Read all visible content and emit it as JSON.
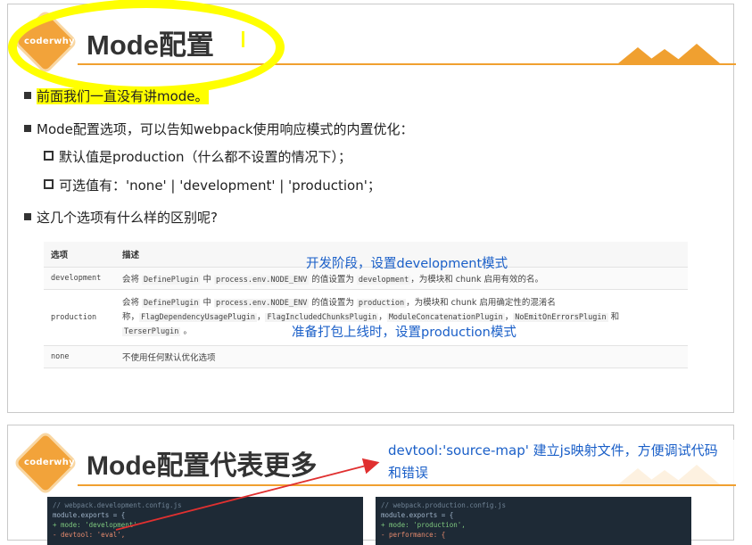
{
  "slide1": {
    "logo_text": "coderwhy",
    "title": "Mode配置",
    "cursor": "I",
    "bullets": [
      "前面我们一直没有讲mode。",
      "Mode配置选项，可以告知webpack使用响应模式的内置优化：",
      "默认值是production（什么都不设置的情况下）；",
      "可选值有：'none' | 'development' | 'production'；",
      "这几个选项有什么样的区别呢?"
    ],
    "table": {
      "headers": [
        "选项",
        "描述"
      ],
      "rows": [
        {
          "option": "development",
          "desc_parts": [
            "会将 ",
            "DefinePlugin",
            " 中 ",
            "process.env.NODE_ENV",
            " 的值设置为 ",
            "development",
            "，为模块和 chunk 启用有效的名。"
          ]
        },
        {
          "option": "production",
          "desc_line1_parts": [
            "会将 ",
            "DefinePlugin",
            " 中 ",
            "process.env.NODE_ENV",
            " 的值设置为 ",
            "production",
            "，为模块和 chunk 启用确定性的混淆名"
          ],
          "desc_line2_parts": [
            "称，",
            "FlagDependencyUsagePlugin",
            "，",
            "FlagIncludedChunksPlugin",
            "，",
            "ModuleConcatenationPlugin",
            "，",
            "NoEmitOnErrorsPlugin",
            " 和"
          ],
          "desc_line3_parts": [
            "TerserPlugin",
            " 。"
          ]
        },
        {
          "option": "none",
          "desc": "不使用任何默认优化选项"
        }
      ]
    },
    "annotations": {
      "dev": "开发阶段，设置development模式",
      "prod": "准备打包上线时，设置production模式"
    }
  },
  "slide2": {
    "logo_text": "coderwhy",
    "title": "Mode配置代表更多",
    "annotation_line1": "devtool:'source-map' 建立js映射文件，方便调试代码",
    "annotation_line2": "和错误",
    "code_left": {
      "lines": [
        "// webpack.development.config.js",
        "module.exports = {",
        "+ mode: 'development'",
        "- devtool: 'eval',"
      ]
    },
    "code_right": {
      "lines": [
        "// webpack.production.config.js",
        "module.exports = {",
        "+  mode: 'production',",
        "-  performance: {"
      ]
    }
  },
  "colors": {
    "accent": "#f0a030",
    "annotation": "#1a5fc8",
    "highlight": "#ffff00",
    "arrow": "#e03030",
    "code_bg": "#1e2a36"
  }
}
